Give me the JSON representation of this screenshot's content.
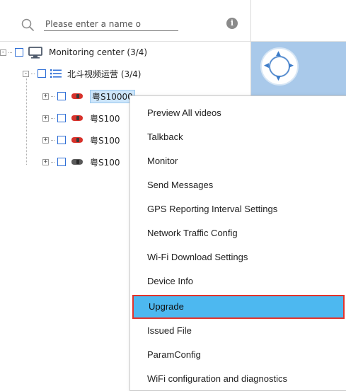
{
  "search": {
    "placeholder": "Please enter a name o"
  },
  "tree": {
    "root": {
      "label": "Monitoring center  (3/4)",
      "toggle": "-"
    },
    "group": {
      "label": "北斗视频运营  (3/4)",
      "toggle": "-"
    },
    "devices": [
      {
        "label": "粤S10000",
        "toggle": "+",
        "selected": true
      },
      {
        "label": "粤S100",
        "toggle": "+",
        "selected": false
      },
      {
        "label": "粤S100",
        "toggle": "+",
        "selected": false
      },
      {
        "label": "粤S100",
        "toggle": "+",
        "selected": false
      }
    ]
  },
  "context_menu": {
    "items": [
      {
        "label": "Preview All videos"
      },
      {
        "label": "Talkback"
      },
      {
        "label": "Monitor"
      },
      {
        "label": "Send Messages"
      },
      {
        "label": "GPS Reporting Interval Settings"
      },
      {
        "label": "Network Traffic Config"
      },
      {
        "label": "Wi-Fi Download Settings"
      },
      {
        "label": "Device Info"
      },
      {
        "label": "Upgrade",
        "highlighted": true
      },
      {
        "label": "Issued File"
      },
      {
        "label": "ParamConfig"
      },
      {
        "label": "WiFi configuration and diagnostics"
      }
    ]
  },
  "colors": {
    "accent_blue": "#2f6fd6",
    "menu_highlight": "#4db8f0",
    "highlight_border": "#e3332b",
    "car_red": "#d8322b",
    "car_gray": "#5a5a5a",
    "video_bg": "#a9c9ea"
  },
  "icons": {
    "search": "search-icon",
    "info": "info-icon",
    "monitor": "monitor-icon",
    "list": "list-icon",
    "car_online": "car-red-icon",
    "car_offline": "car-gray-icon",
    "ptz": "ptz-control-icon"
  }
}
